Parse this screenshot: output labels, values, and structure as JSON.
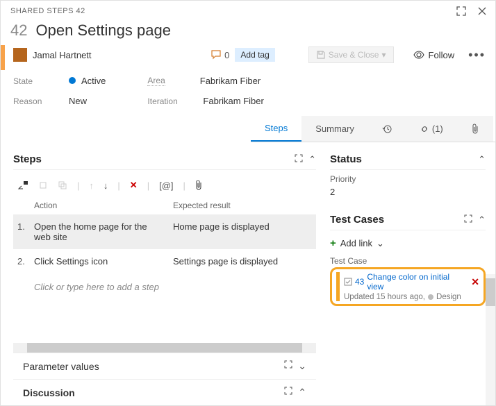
{
  "topbar": {
    "label": "SHARED STEPS 42"
  },
  "header": {
    "id": "42",
    "title": "Open Settings page"
  },
  "meta": {
    "assignee": "Jamal Hartnett",
    "commentCount": "0",
    "addTag": "Add tag",
    "save": "Save & Close",
    "follow": "Follow"
  },
  "fields": {
    "stateLabel": "State",
    "stateValue": "Active",
    "reasonLabel": "Reason",
    "reasonValue": "New",
    "areaLabel": "Area",
    "areaValue": "Fabrikam Fiber",
    "iterationLabel": "Iteration",
    "iterationValue": "Fabrikam Fiber"
  },
  "tabs": {
    "steps": "Steps",
    "summary": "Summary",
    "linksCount": "(1)"
  },
  "steps": {
    "title": "Steps",
    "colAction": "Action",
    "colResult": "Expected result",
    "rows": [
      {
        "num": "1.",
        "action": "Open the home page for the web site",
        "result": "Home page is displayed"
      },
      {
        "num": "2.",
        "action": "Click Settings icon",
        "result": "Settings page is displayed"
      }
    ],
    "placeholder": "Click or type here to add a step"
  },
  "paramSection": "Parameter values",
  "discussion": "Discussion",
  "status": {
    "title": "Status",
    "priorityLabel": "Priority",
    "priorityValue": "2"
  },
  "testCases": {
    "title": "Test Cases",
    "addLink": "Add link",
    "label": "Test Case",
    "card": {
      "id": "43",
      "title": "Change color on initial view",
      "updated": "Updated 15 hours ago,",
      "state": "Design"
    }
  }
}
